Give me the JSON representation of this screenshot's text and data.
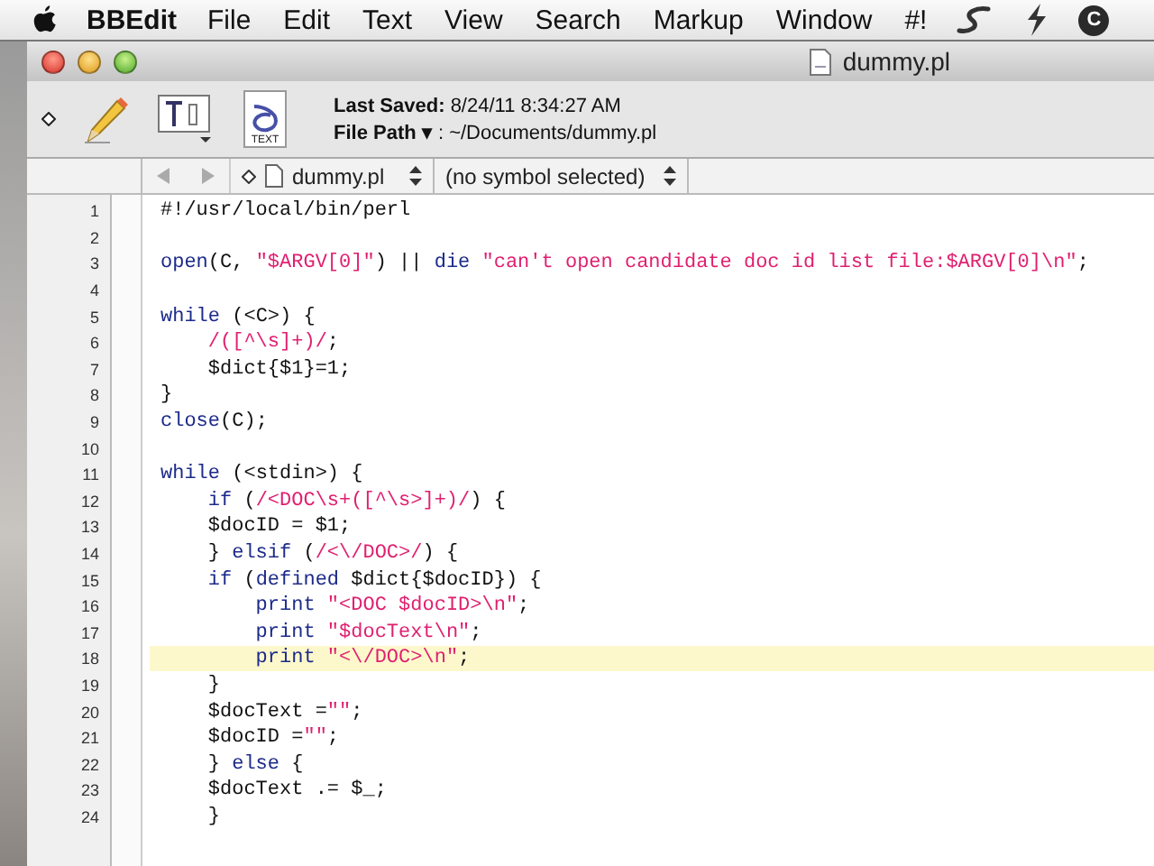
{
  "menu_bar": {
    "app_name": "BBEdit",
    "items": [
      "File",
      "Edit",
      "Text",
      "View",
      "Search",
      "Markup",
      "Window",
      "#!"
    ],
    "status_letter": "C"
  },
  "window": {
    "title": "dummy.pl"
  },
  "toolbar": {
    "last_saved_label": "Last Saved:",
    "last_saved_value": "8/24/11 8:34:27 AM",
    "file_path_label": "File Path",
    "file_path_caret": "▾",
    "file_path_value": ": ~/Documents/dummy.pl",
    "doc_icon_label": "TEXT"
  },
  "navigation_bar": {
    "file_menu": "dummy.pl",
    "symbol_menu": "(no symbol selected)"
  },
  "editor": {
    "lines": [
      {
        "number": "1",
        "highlighted": false,
        "segments": [
          {
            "kind": "plain",
            "text": "#!/usr/local/bin/perl"
          }
        ]
      },
      {
        "number": "2",
        "highlighted": false
      },
      {
        "number": "3",
        "highlighted": false,
        "segments": [
          {
            "kind": "keyword",
            "text": "open"
          },
          {
            "kind": "plain",
            "text": "(C, "
          },
          {
            "kind": "string",
            "text": "\"$ARGV[0]\""
          },
          {
            "kind": "plain",
            "text": ") || "
          },
          {
            "kind": "keyword",
            "text": "die"
          },
          {
            "kind": "string",
            "text": " \"can't open candidate doc id list file:$ARGV[0]\\n\""
          },
          {
            "kind": "plain",
            "text": ";"
          }
        ]
      },
      {
        "number": "4",
        "highlighted": false
      },
      {
        "number": "5",
        "highlighted": false,
        "segments": [
          {
            "kind": "keyword",
            "text": "while"
          },
          {
            "kind": "plain",
            "text": " (<C>) {"
          }
        ]
      },
      {
        "number": "6",
        "highlighted": false,
        "segments": [
          {
            "kind": "string",
            "text": "    /([^\\s]+)/"
          },
          {
            "kind": "plain",
            "text": ";"
          }
        ]
      },
      {
        "number": "7",
        "highlighted": false,
        "segments": [
          {
            "kind": "plain",
            "text": "    $dict{$1}=1;"
          }
        ]
      },
      {
        "number": "8",
        "highlighted": false,
        "segments": [
          {
            "kind": "plain",
            "text": "}"
          }
        ]
      },
      {
        "number": "9",
        "highlighted": false,
        "segments": [
          {
            "kind": "keyword",
            "text": "close"
          },
          {
            "kind": "plain",
            "text": "(C);"
          }
        ]
      },
      {
        "number": "10",
        "highlighted": false
      },
      {
        "number": "11",
        "highlighted": false,
        "segments": [
          {
            "kind": "keyword",
            "text": "while"
          },
          {
            "kind": "plain",
            "text": " (<stdin>) {"
          }
        ]
      },
      {
        "number": "12",
        "highlighted": false,
        "segments": [
          {
            "kind": "keyword",
            "text": "    if"
          },
          {
            "kind": "plain",
            "text": " ("
          },
          {
            "kind": "string",
            "text": "/<DOC\\s+([^\\s>]+)/"
          },
          {
            "kind": "plain",
            "text": ") {"
          }
        ]
      },
      {
        "number": "13",
        "highlighted": false,
        "segments": [
          {
            "kind": "plain",
            "text": "    $docID = $1;"
          }
        ]
      },
      {
        "number": "14",
        "highlighted": false,
        "segments": [
          {
            "kind": "plain",
            "text": "    } "
          },
          {
            "kind": "keyword",
            "text": "elsif"
          },
          {
            "kind": "plain",
            "text": " ("
          },
          {
            "kind": "string",
            "text": "/<\\/DOC>/"
          },
          {
            "kind": "plain",
            "text": ") {"
          }
        ]
      },
      {
        "number": "15",
        "highlighted": false,
        "segments": [
          {
            "kind": "keyword",
            "text": "    if"
          },
          {
            "kind": "plain",
            "text": " ("
          },
          {
            "kind": "keyword",
            "text": "defined"
          },
          {
            "kind": "plain",
            "text": " $dict{$docID}) {"
          }
        ]
      },
      {
        "number": "16",
        "highlighted": false,
        "segments": [
          {
            "kind": "keyword",
            "text": "        print"
          },
          {
            "kind": "string",
            "text": " \"<DOC $docID>\\n\""
          },
          {
            "kind": "plain",
            "text": ";"
          }
        ]
      },
      {
        "number": "17",
        "highlighted": false,
        "segments": [
          {
            "kind": "keyword",
            "text": "        print"
          },
          {
            "kind": "string",
            "text": " \"$docText\\n\""
          },
          {
            "kind": "plain",
            "text": ";"
          }
        ]
      },
      {
        "number": "18",
        "highlighted": true,
        "segments": [
          {
            "kind": "keyword",
            "text": "        print"
          },
          {
            "kind": "string",
            "text": " \"<\\/DOC>\\n\""
          },
          {
            "kind": "plain",
            "text": ";"
          }
        ]
      },
      {
        "number": "19",
        "highlighted": false,
        "segments": [
          {
            "kind": "plain",
            "text": "    }"
          }
        ]
      },
      {
        "number": "20",
        "highlighted": false,
        "segments": [
          {
            "kind": "plain",
            "text": "    $docText ="
          },
          {
            "kind": "string",
            "text": "\"\""
          },
          {
            "kind": "plain",
            "text": ";"
          }
        ]
      },
      {
        "number": "21",
        "highlighted": false,
        "segments": [
          {
            "kind": "plain",
            "text": "    $docID ="
          },
          {
            "kind": "string",
            "text": "\"\""
          },
          {
            "kind": "plain",
            "text": ";"
          }
        ]
      },
      {
        "number": "22",
        "highlighted": false,
        "segments": [
          {
            "kind": "plain",
            "text": "    } "
          },
          {
            "kind": "keyword",
            "text": "else"
          },
          {
            "kind": "plain",
            "text": " {"
          }
        ]
      },
      {
        "number": "23",
        "highlighted": false,
        "segments": [
          {
            "kind": "plain",
            "text": "    $docText .= $_;"
          }
        ]
      },
      {
        "number": "24",
        "highlighted": false,
        "segments": [
          {
            "kind": "plain",
            "text": "    }"
          }
        ]
      }
    ]
  }
}
